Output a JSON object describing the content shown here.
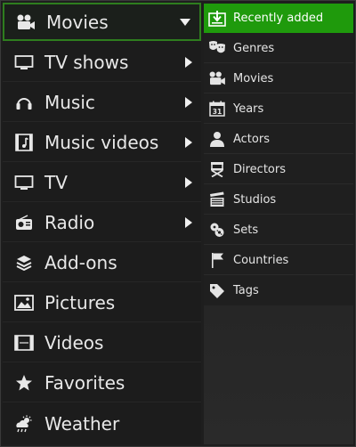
{
  "main_menu": {
    "items": [
      {
        "label": "Movies",
        "icon": "camera-icon",
        "arrow": "down",
        "active": true
      },
      {
        "label": "TV shows",
        "icon": "monitor-icon",
        "arrow": "right"
      },
      {
        "label": "Music",
        "icon": "headphones-icon",
        "arrow": "right"
      },
      {
        "label": "Music videos",
        "icon": "music-video-icon",
        "arrow": "right"
      },
      {
        "label": "TV",
        "icon": "tv-icon",
        "arrow": "right"
      },
      {
        "label": "Radio",
        "icon": "radio-icon",
        "arrow": "right"
      },
      {
        "label": "Add-ons",
        "icon": "addons-icon",
        "arrow": ""
      },
      {
        "label": "Pictures",
        "icon": "pictures-icon",
        "arrow": ""
      },
      {
        "label": "Videos",
        "icon": "film-icon",
        "arrow": ""
      },
      {
        "label": "Favorites",
        "icon": "star-icon",
        "arrow": ""
      },
      {
        "label": "Weather",
        "icon": "weather-icon",
        "arrow": ""
      }
    ]
  },
  "sub_menu": {
    "items": [
      {
        "label": "Recently added",
        "icon": "download-icon",
        "active": true
      },
      {
        "label": "Genres",
        "icon": "masks-icon"
      },
      {
        "label": "Movies",
        "icon": "camera-icon"
      },
      {
        "label": "Years",
        "icon": "calendar-icon",
        "calendar_day": "31"
      },
      {
        "label": "Actors",
        "icon": "person-icon"
      },
      {
        "label": "Directors",
        "icon": "director-chair-icon"
      },
      {
        "label": "Studios",
        "icon": "clapperboard-icon"
      },
      {
        "label": "Sets",
        "icon": "sets-icon"
      },
      {
        "label": "Countries",
        "icon": "flag-icon"
      },
      {
        "label": "Tags",
        "icon": "tag-icon"
      }
    ]
  },
  "colors": {
    "accent_green": "#1f9a0c",
    "focus_border": "#2e7d1e",
    "background": "#1c1c1c"
  }
}
